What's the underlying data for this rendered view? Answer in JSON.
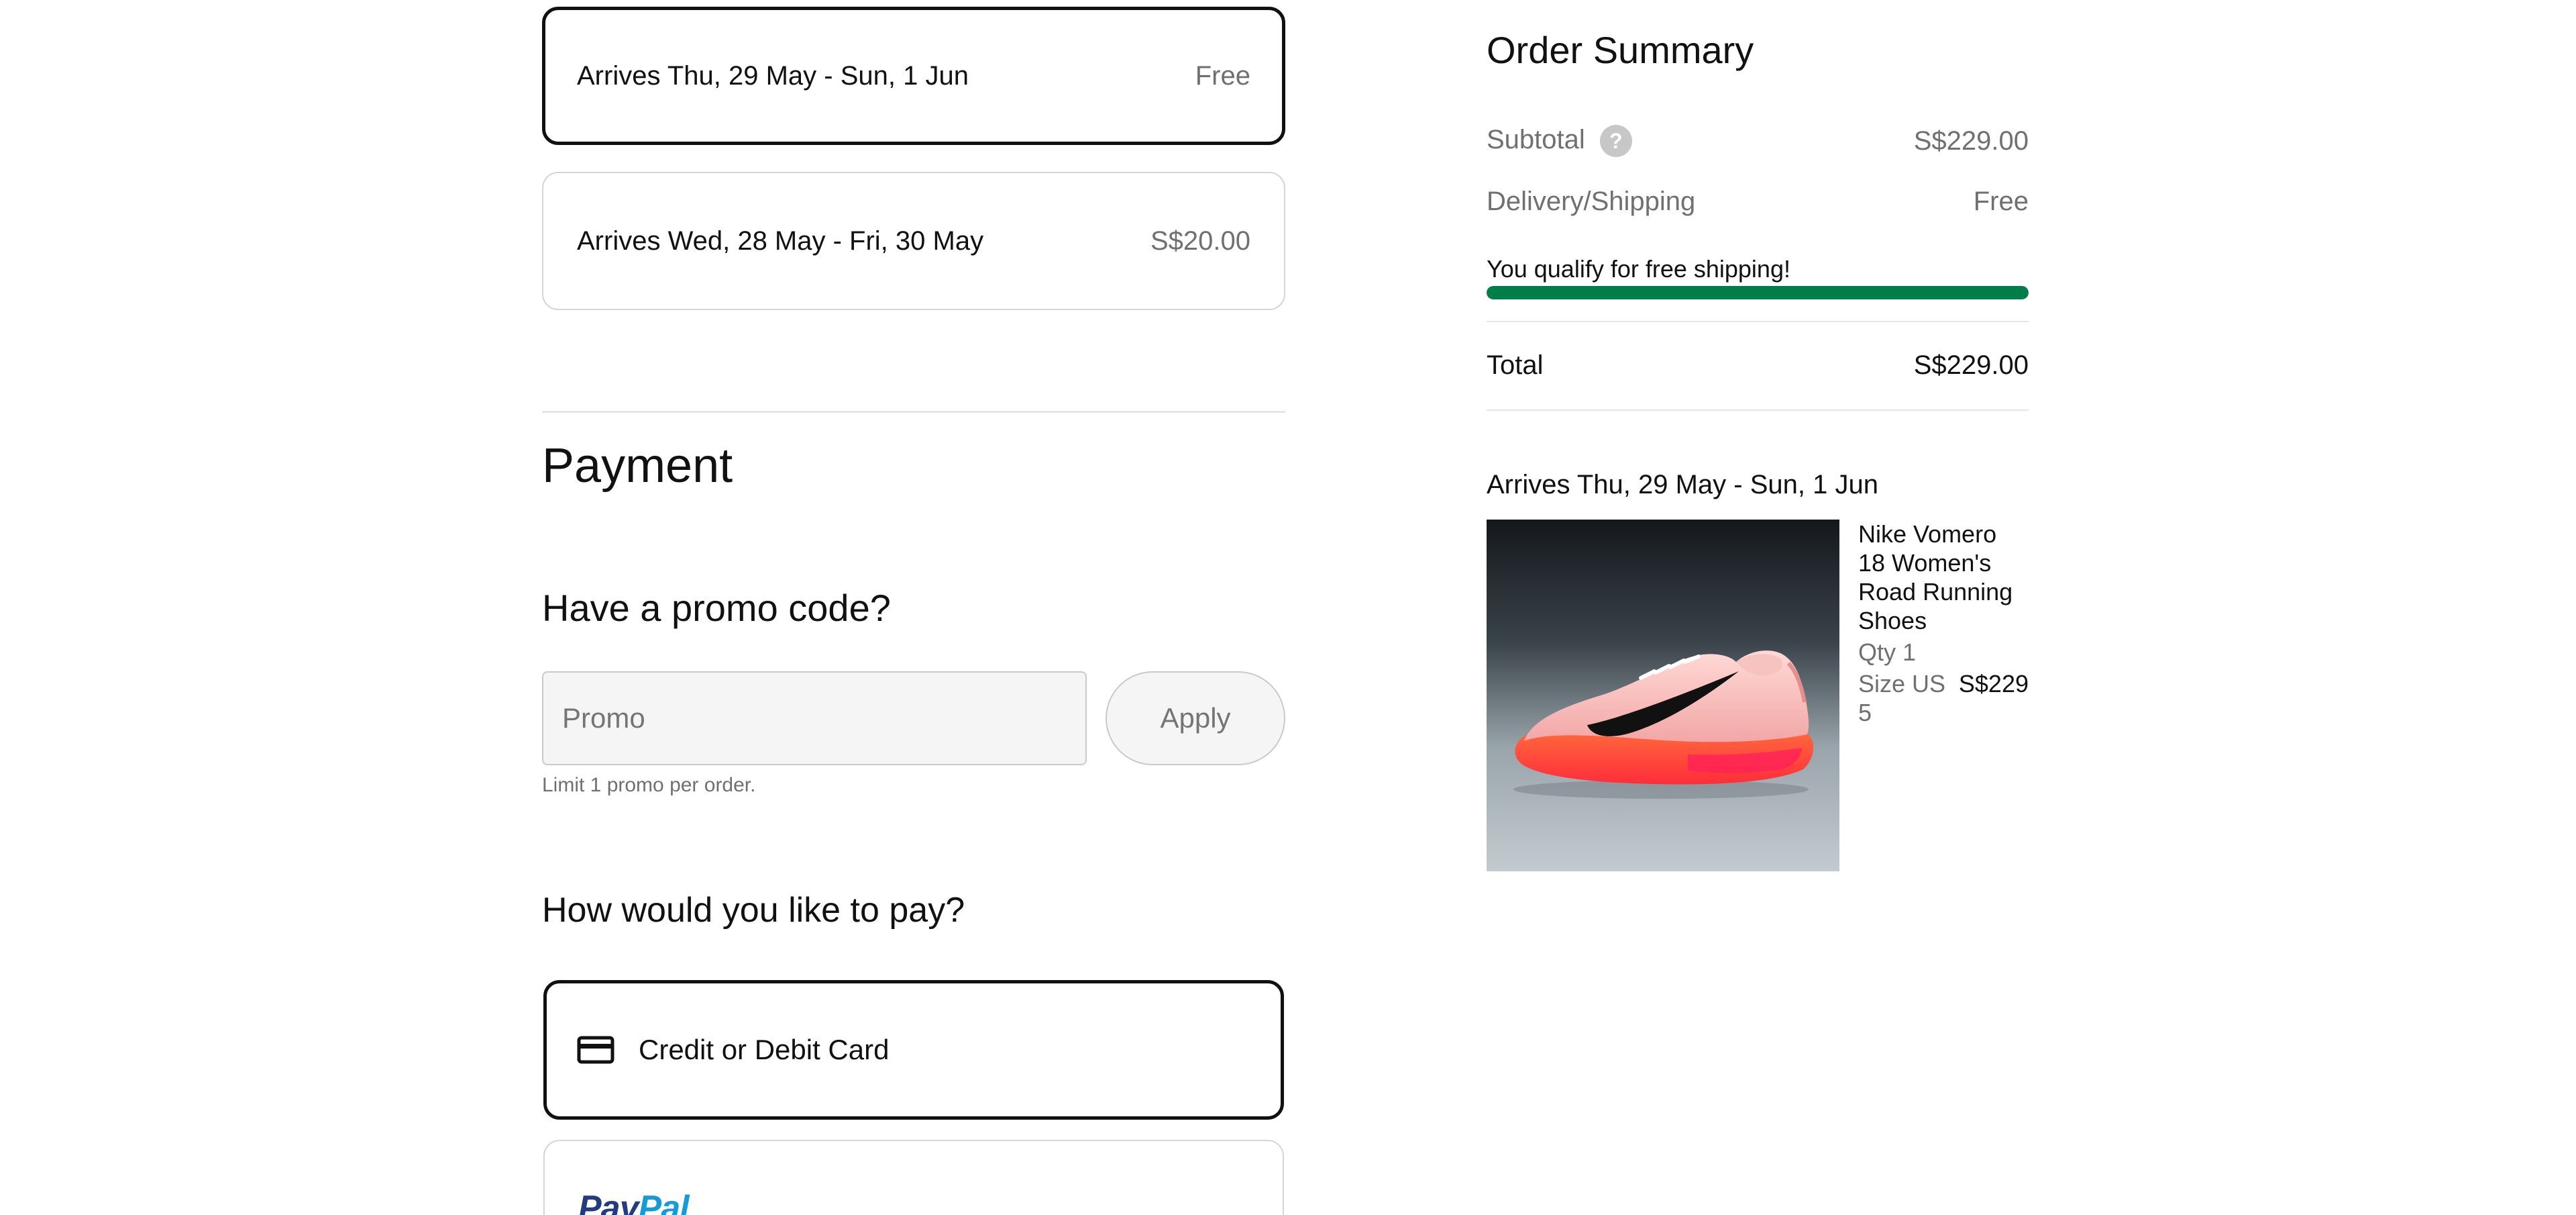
{
  "shipping_options": [
    {
      "label": "Arrives Thu, 29 May - Sun, 1 Jun",
      "price": "Free",
      "selected": true
    },
    {
      "label": "Arrives Wed, 28 May - Fri, 30 May",
      "price": "S$20.00",
      "selected": false
    }
  ],
  "payment": {
    "title": "Payment",
    "promo_title": "Have a promo code?",
    "promo_placeholder": "Promo",
    "apply_label": "Apply",
    "promo_note": "Limit 1 promo per order.",
    "pay_title": "How would you like to pay?",
    "methods": [
      {
        "label": "Credit or Debit Card",
        "icon": "credit-card-icon",
        "selected": true
      },
      {
        "label": "PayPal",
        "icon": "paypal-logo",
        "selected": false
      }
    ]
  },
  "summary": {
    "title": "Order Summary",
    "subtotal_label": "Subtotal",
    "subtotal_value": "S$229.00",
    "shipping_label": "Delivery/Shipping",
    "shipping_value": "Free",
    "free_shipping_message": "You qualify for free shipping!",
    "free_shipping_progress": 1.0,
    "total_label": "Total",
    "total_value": "S$229.00",
    "arrives": "Arrives Thu, 29 May - Sun, 1 Jun",
    "product": {
      "name": "Nike Vomero 18 Women's Road Running Shoes",
      "qty": "Qty 1",
      "size": "Size US 5",
      "price": "S$229"
    }
  },
  "colors": {
    "accent_green": "#007d48",
    "text": "#111111",
    "muted": "#707072"
  }
}
